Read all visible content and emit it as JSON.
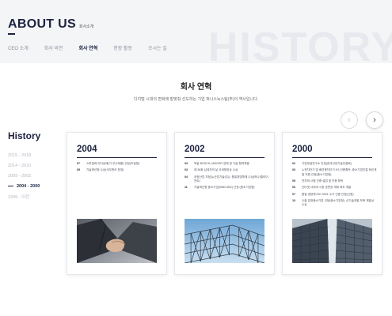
{
  "header": {
    "title": "ABOUT US",
    "subtitle": "회사소개",
    "watermark": "HISTORY",
    "nav": [
      {
        "label": "CEO 소개",
        "active": false
      },
      {
        "label": "회사 비전",
        "active": false
      },
      {
        "label": "회사 연혁",
        "active": true
      },
      {
        "label": "현장 활동",
        "active": false
      },
      {
        "label": "오시는 길",
        "active": false
      }
    ]
  },
  "section": {
    "title": "회사 연혁",
    "description": "디지털 시대의 변화에 발맞춰 선도하는 기업 퍼니스녹스팀(주)의 역사입니다."
  },
  "history": {
    "title": "History",
    "ranges": [
      {
        "label": "2015 - 2018",
        "active": false
      },
      {
        "label": "2014 - 2010",
        "active": false
      },
      {
        "label": "2009 - 2005",
        "active": false
      },
      {
        "label": "2004 - 2000",
        "active": true
      },
      {
        "label": "1999 - 이전",
        "active": false
      }
    ]
  },
  "carousel": {
    "prev_icon": "chevron-left-icon",
    "next_icon": "chevron-right-icon",
    "prev_symbol": "‹",
    "next_symbol": "›"
  },
  "cards": [
    {
      "year": "2004",
      "image": "handshake-photo",
      "entries": [
        {
          "month": "07",
          "text": "스마일레 리더십에(기 우수제품) 인정(조달청)"
        },
        {
          "month": "05",
          "text": "기술혁신형 수상(국무총리 표창)"
        }
      ]
    },
    {
      "year": "2002",
      "image": "steel-structure-photo",
      "entries": [
        {
          "month": "03",
          "text": "독일 BOSCH-JAEGER 업체 및 기술 협력체결"
        },
        {
          "month": "03",
          "text": "제 36회 납세자의 날 국세청장상 수상"
        },
        {
          "month": "04",
          "text": "공정산업 지정(뉴산업기술(주)), 품질경영체제 수상(하나/클라이언트)"
        },
        {
          "month": "11",
          "text": "기술혁신형 중소기업(INNO-BIZ) 선정 (중소기업청)"
        }
      ]
    },
    {
      "year": "2000",
      "image": "glass-building-photo",
      "entries": [
        {
          "month": "02",
          "text": "기업부설연구소 인정(한국산업기술진흥회)"
        },
        {
          "month": "03",
          "text": "누전차단기 및 배선용차단기 KS 인증획득, 중소기업진흥 혁신개발 지원 선정(중소기업청)"
        },
        {
          "month": "05",
          "text": "전자파 시험 인증 설립 및 인증 획득"
        },
        {
          "month": "06",
          "text": "인터넷 사이버 시장 공판장 세계 최초 개발"
        },
        {
          "month": "07",
          "text": "품질 경영체 ISO 9001 수기 인증 인정(신청)"
        },
        {
          "month": "10",
          "text": "수출 유망중소기업 선정(중소기업청), 신기술개발 보육 개발상 수상"
        }
      ]
    }
  ]
}
